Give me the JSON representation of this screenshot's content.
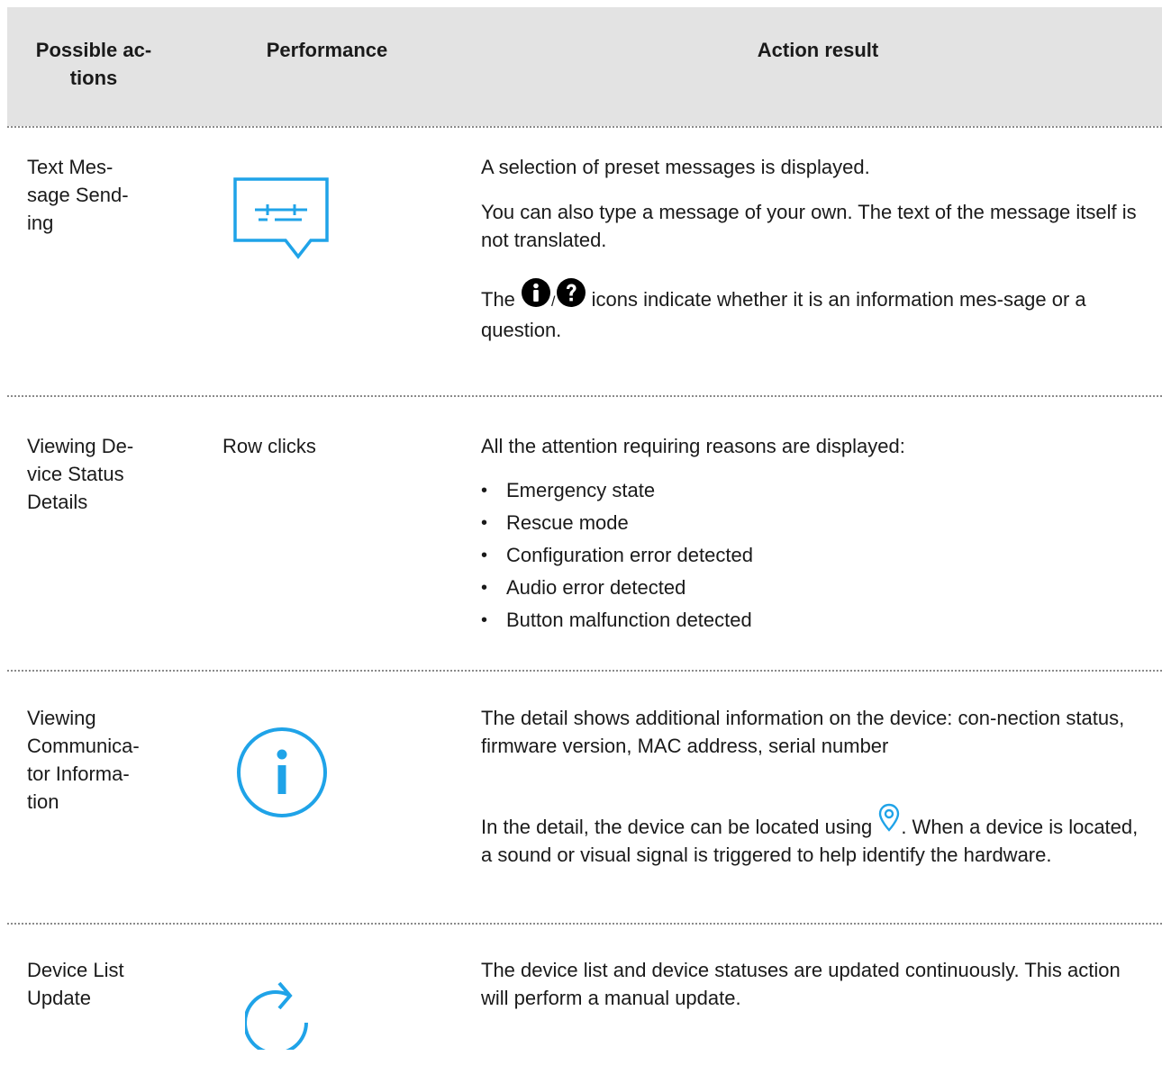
{
  "header": {
    "col1": "Possible ac-\ntions",
    "col2": "Performance",
    "col3": "Action result"
  },
  "rows": [
    {
      "action": "Text Mes-\nsage Send-\ning",
      "performance_icon": "message-icon",
      "result": {
        "p1": "A selection of preset messages is displayed.",
        "p2": "You can also type a message of your own. The text of the message itself is not translated.",
        "p3_before": "The",
        "p3_sep": "/",
        "p3_after": "icons indicate whether it is an information mes-sage or a question."
      }
    },
    {
      "action": "Viewing De-\nvice Status\nDetails",
      "performance": "Row clicks",
      "result": {
        "p1": "All the attention requiring reasons are displayed:",
        "items": [
          "Emergency state",
          "Rescue mode",
          "Configuration error detected",
          "Audio error detected",
          "Button malfunction detected"
        ]
      }
    },
    {
      "action": "Viewing\nCommunica-\ntor Informa-\ntion",
      "performance_icon": "info-circle-icon",
      "result": {
        "p1": "The detail shows additional information on the device: con-nection status, firmware version, MAC address, serial number",
        "p2_before": "In the detail, the device can be located using",
        "p2_after": ". When a device is located, a sound or visual signal is triggered to help identify the hardware."
      }
    },
    {
      "action": "Device List\nUpdate",
      "performance_icon": "refresh-icon",
      "result": {
        "p1": "The device list and device statuses are updated continuously. This action will perform a manual update."
      }
    }
  ],
  "colors": {
    "header_bg": "#e3e3e3",
    "icon_blue": "#1fa3e8",
    "separator": "#8a8a8a",
    "text": "#1a1a1a"
  }
}
